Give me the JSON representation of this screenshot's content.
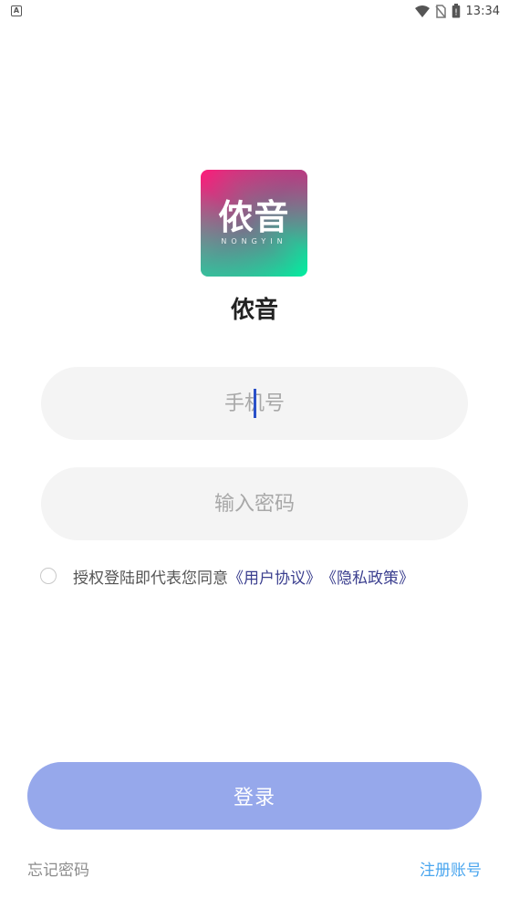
{
  "status_bar": {
    "left_badge": "A",
    "battery_glyph": "!",
    "time": "13:34"
  },
  "logo": {
    "main_text": "侬音",
    "sub_text": "NONGYIN"
  },
  "app_name": "侬音",
  "form": {
    "phone_placeholder": "手机号",
    "password_placeholder": "输入密码"
  },
  "agreement": {
    "prefix": "授权登陆即代表您同意",
    "user_agreement": "《用户协议》",
    "privacy_policy": "《隐私政策》"
  },
  "login_label": "登录",
  "forgot_label": "忘记密码",
  "register_label": "注册账号",
  "colors": {
    "login_button": "#96a8eb",
    "register_link": "#4aa6ef",
    "agreement_link": "#3b3f8f"
  }
}
